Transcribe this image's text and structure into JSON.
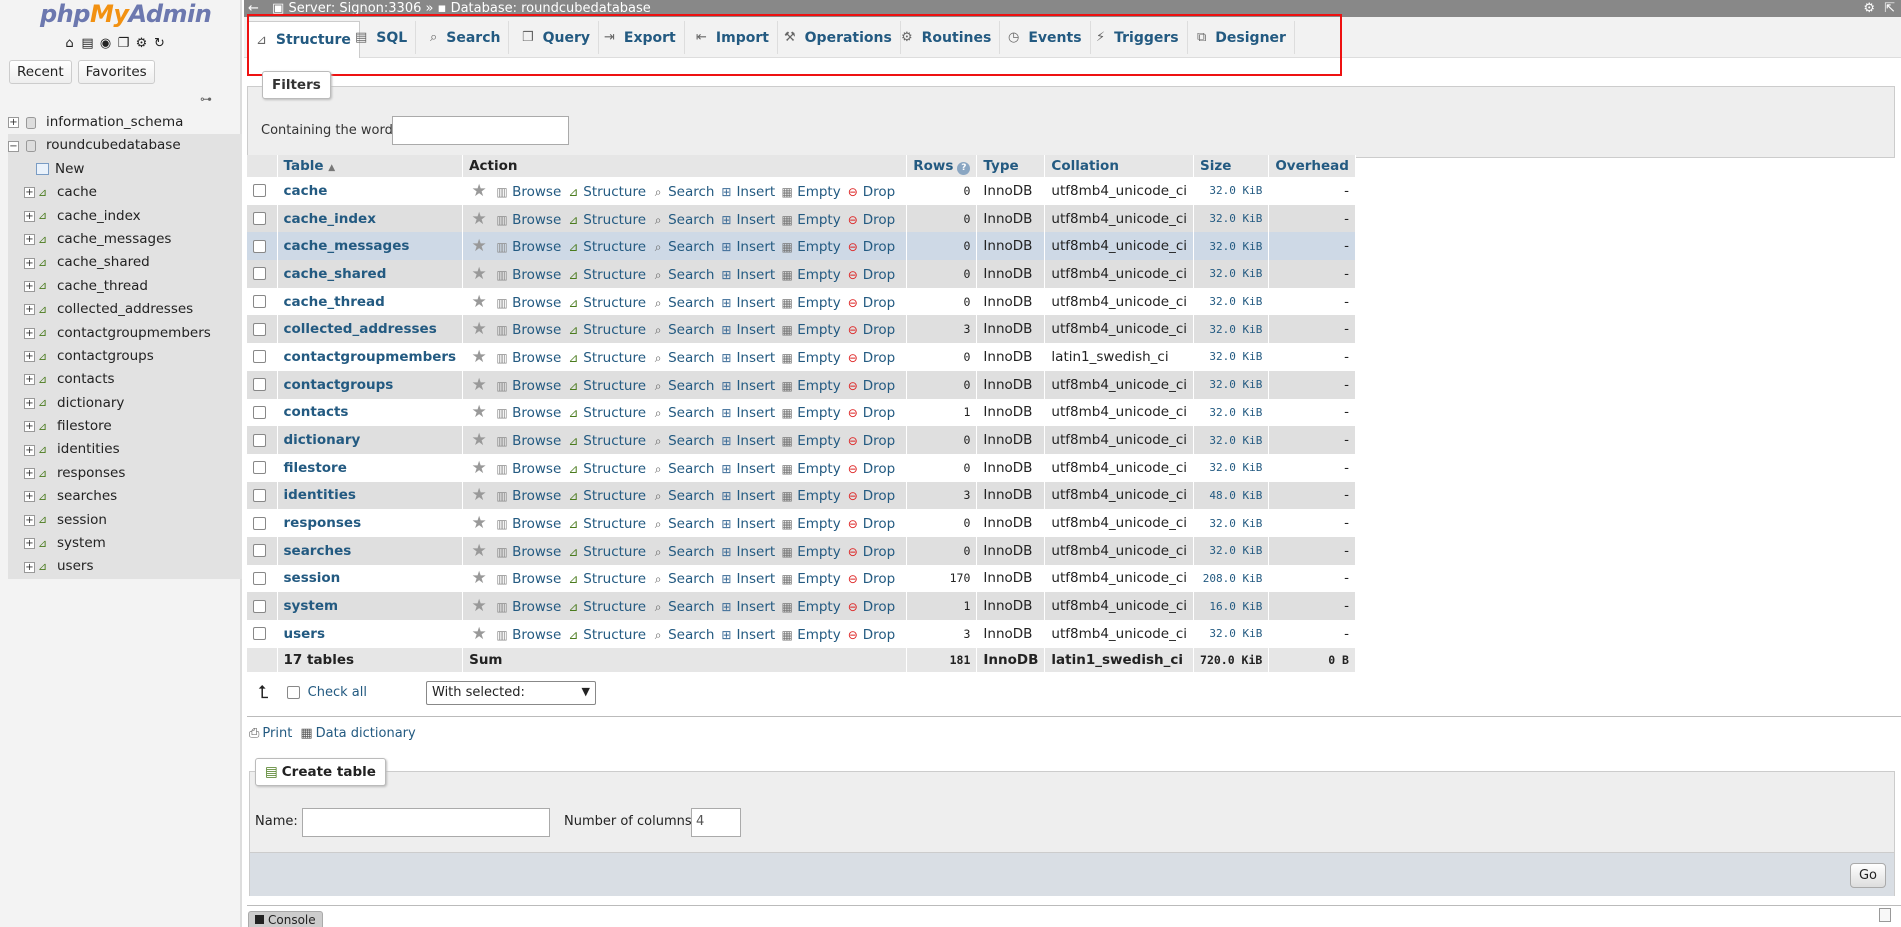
{
  "nav": {
    "logo": {
      "php": "php",
      "my": "My",
      "admin": "Admin"
    },
    "tabs": [
      "Recent",
      "Favorites"
    ],
    "databases": [
      {
        "name": "information_schema",
        "selected": false
      },
      {
        "name": "roundcubedatabase",
        "selected": true
      }
    ],
    "new_label": "New",
    "tables": [
      "cache",
      "cache_index",
      "cache_messages",
      "cache_shared",
      "cache_thread",
      "collected_addresses",
      "contactgroupmembers",
      "contactgroups",
      "contacts",
      "dictionary",
      "filestore",
      "identities",
      "responses",
      "searches",
      "session",
      "system",
      "users"
    ]
  },
  "topbar": {
    "server": "Server: Signon:3306",
    "sep": "»",
    "database": "Database: roundcubedatabase"
  },
  "menu": {
    "tabs": [
      {
        "label": "Structure",
        "icon": "structure-icon",
        "active": true
      },
      {
        "label": "SQL",
        "icon": "sql-icon"
      },
      {
        "label": "Search",
        "icon": "search-icon"
      },
      {
        "label": "Query",
        "icon": "query-icon"
      },
      {
        "label": "Export",
        "icon": "export-icon"
      },
      {
        "label": "Import",
        "icon": "import-icon"
      },
      {
        "label": "Operations",
        "icon": "wrench-icon"
      },
      {
        "label": "Routines",
        "icon": "routines-icon"
      },
      {
        "label": "Events",
        "icon": "clock-icon"
      },
      {
        "label": "Triggers",
        "icon": "triggers-icon"
      },
      {
        "label": "Designer",
        "icon": "designer-icon"
      }
    ]
  },
  "filters": {
    "legend": "Filters",
    "label": "Containing the word:",
    "value": ""
  },
  "table": {
    "headers": {
      "table": "Table",
      "action": "Action",
      "rows": "Rows",
      "type": "Type",
      "collation": "Collation",
      "size": "Size",
      "overhead": "Overhead"
    },
    "actions": [
      "Browse",
      "Structure",
      "Search",
      "Insert",
      "Empty",
      "Drop"
    ],
    "rows": [
      {
        "name": "cache",
        "rows": "0",
        "type": "InnoDB",
        "collation": "utf8mb4_unicode_ci",
        "size": "32.0 KiB",
        "overhead": "-"
      },
      {
        "name": "cache_index",
        "rows": "0",
        "type": "InnoDB",
        "collation": "utf8mb4_unicode_ci",
        "size": "32.0 KiB",
        "overhead": "-"
      },
      {
        "name": "cache_messages",
        "rows": "0",
        "type": "InnoDB",
        "collation": "utf8mb4_unicode_ci",
        "size": "32.0 KiB",
        "overhead": "-"
      },
      {
        "name": "cache_shared",
        "rows": "0",
        "type": "InnoDB",
        "collation": "utf8mb4_unicode_ci",
        "size": "32.0 KiB",
        "overhead": "-"
      },
      {
        "name": "cache_thread",
        "rows": "0",
        "type": "InnoDB",
        "collation": "utf8mb4_unicode_ci",
        "size": "32.0 KiB",
        "overhead": "-"
      },
      {
        "name": "collected_addresses",
        "rows": "3",
        "type": "InnoDB",
        "collation": "utf8mb4_unicode_ci",
        "size": "32.0 KiB",
        "overhead": "-"
      },
      {
        "name": "contactgroupmembers",
        "rows": "0",
        "type": "InnoDB",
        "collation": "latin1_swedish_ci",
        "size": "32.0 KiB",
        "overhead": "-"
      },
      {
        "name": "contactgroups",
        "rows": "0",
        "type": "InnoDB",
        "collation": "utf8mb4_unicode_ci",
        "size": "32.0 KiB",
        "overhead": "-"
      },
      {
        "name": "contacts",
        "rows": "1",
        "type": "InnoDB",
        "collation": "utf8mb4_unicode_ci",
        "size": "32.0 KiB",
        "overhead": "-"
      },
      {
        "name": "dictionary",
        "rows": "0",
        "type": "InnoDB",
        "collation": "utf8mb4_unicode_ci",
        "size": "32.0 KiB",
        "overhead": "-"
      },
      {
        "name": "filestore",
        "rows": "0",
        "type": "InnoDB",
        "collation": "utf8mb4_unicode_ci",
        "size": "32.0 KiB",
        "overhead": "-"
      },
      {
        "name": "identities",
        "rows": "3",
        "type": "InnoDB",
        "collation": "utf8mb4_unicode_ci",
        "size": "48.0 KiB",
        "overhead": "-"
      },
      {
        "name": "responses",
        "rows": "0",
        "type": "InnoDB",
        "collation": "utf8mb4_unicode_ci",
        "size": "32.0 KiB",
        "overhead": "-"
      },
      {
        "name": "searches",
        "rows": "0",
        "type": "InnoDB",
        "collation": "utf8mb4_unicode_ci",
        "size": "32.0 KiB",
        "overhead": "-"
      },
      {
        "name": "session",
        "rows": "170",
        "type": "InnoDB",
        "collation": "utf8mb4_unicode_ci",
        "size": "208.0 KiB",
        "overhead": "-"
      },
      {
        "name": "system",
        "rows": "1",
        "type": "InnoDB",
        "collation": "utf8mb4_unicode_ci",
        "size": "16.0 KiB",
        "overhead": "-"
      },
      {
        "name": "users",
        "rows": "3",
        "type": "InnoDB",
        "collation": "utf8mb4_unicode_ci",
        "size": "32.0 KiB",
        "overhead": "-"
      }
    ],
    "footer": {
      "count": "17 tables",
      "sum": "Sum",
      "rows": "181",
      "type": "InnoDB",
      "collation": "latin1_swedish_ci",
      "size": "720.0 KiB",
      "overhead": "0 B"
    }
  },
  "bulk": {
    "check_all": "Check all",
    "with_selected": "With selected:"
  },
  "links": {
    "print": "Print",
    "data_dictionary": "Data dictionary"
  },
  "create": {
    "legend": "Create table",
    "name_label": "Name:",
    "name_value": "",
    "columns_label": "Number of columns:",
    "columns_value": "4",
    "go": "Go"
  },
  "console": {
    "label": "Console"
  }
}
